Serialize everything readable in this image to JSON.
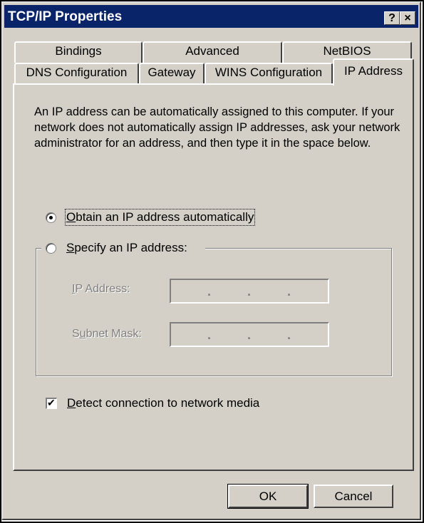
{
  "window": {
    "title": "TCP/IP Properties",
    "help_button": "?",
    "close_button": "×"
  },
  "tabs": {
    "row1": [
      "Bindings",
      "Advanced",
      "NetBIOS"
    ],
    "row2": [
      "DNS Configuration",
      "Gateway",
      "WINS Configuration",
      "IP Address"
    ],
    "active": "IP Address"
  },
  "description": "An IP address can be automatically assigned to this computer. If your network does not automatically assign IP addresses, ask your network administrator for an address, and then type it in the space below.",
  "options": {
    "obtain_auto": {
      "accesskey": "O",
      "rest": "btain an IP address automatically",
      "selected": true
    },
    "specify": {
      "accesskey": "S",
      "rest": "pecify an IP address:",
      "selected": false
    }
  },
  "fields": {
    "ip_address_label": {
      "accesskey": "I",
      "rest": "P Address:"
    },
    "subnet_mask_label": {
      "pre": "S",
      "accesskey": "u",
      "rest": "bnet Mask:"
    },
    "separator": "."
  },
  "detect": {
    "accesskey": "D",
    "rest": "etect connection to network media",
    "checked": true,
    "check_glyph": "✔"
  },
  "buttons": {
    "ok": "OK",
    "cancel": "Cancel"
  }
}
